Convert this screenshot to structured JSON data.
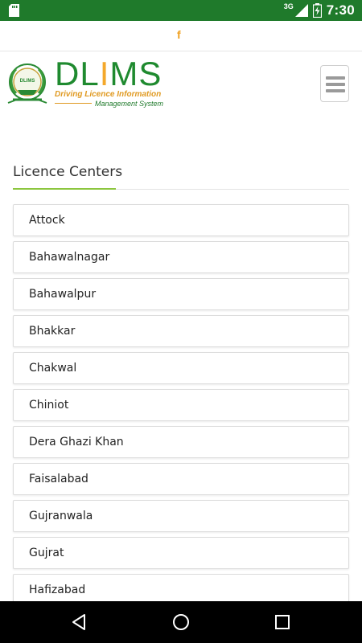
{
  "status_bar": {
    "network": "3G",
    "time": "7:30"
  },
  "social": {
    "facebook_glyph": "f"
  },
  "brand": {
    "name_prefix": "DL",
    "name_accent": "I",
    "name_suffix": "MS",
    "line1": "Driving Licence Information",
    "line2": "Management System",
    "emblem_text": "DLIMS"
  },
  "section": {
    "title": "Licence Centers"
  },
  "centers": [
    "Attock",
    "Bahawalnagar",
    "Bahawalpur",
    "Bhakkar",
    "Chakwal",
    "Chiniot",
    "Dera Ghazi Khan",
    "Faisalabad",
    "Gujranwala",
    "Gujrat",
    "Hafizabad"
  ],
  "colors": {
    "status_bar": "#1f7a2b",
    "brand_green": "#1f8a2f",
    "brand_orange": "#f4a82b",
    "accent_line": "#8cc63e"
  }
}
